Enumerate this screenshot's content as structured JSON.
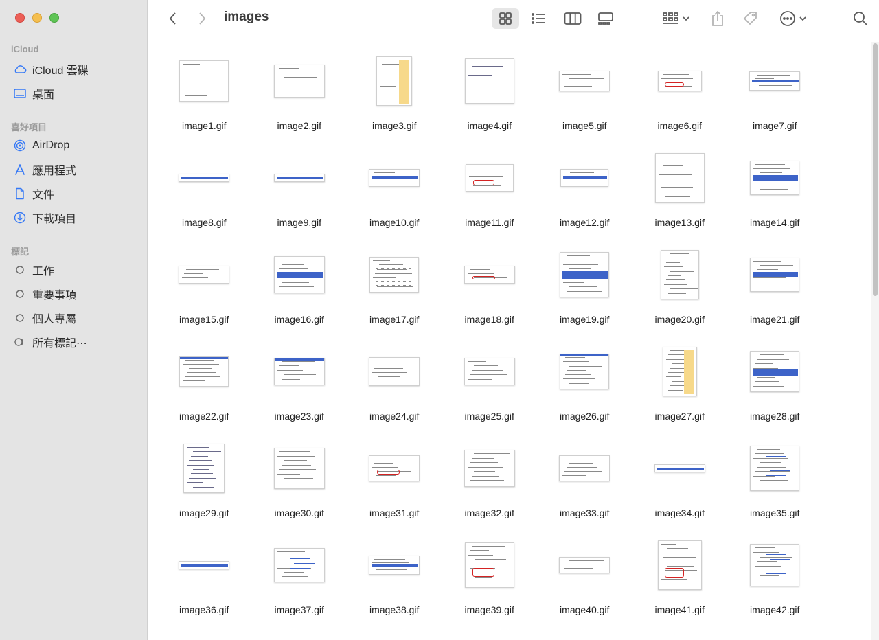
{
  "window": {
    "folder_title": "images"
  },
  "sidebar": {
    "icloud_header": "iCloud",
    "icloud_items": [
      {
        "label": "iCloud 雲碟",
        "icon": "cloud-icon"
      },
      {
        "label": "桌面",
        "icon": "desktop-icon"
      }
    ],
    "favorites_header": "喜好項目",
    "favorite_items": [
      {
        "label": "AirDrop",
        "icon": "airdrop-icon"
      },
      {
        "label": "應用程式",
        "icon": "applications-icon"
      },
      {
        "label": "文件",
        "icon": "document-icon"
      },
      {
        "label": "下載項目",
        "icon": "download-icon"
      }
    ],
    "tags_header": "標記",
    "tag_items": [
      {
        "label": "工作",
        "icon": "tag-circle-icon"
      },
      {
        "label": "重要事項",
        "icon": "tag-circle-icon"
      },
      {
        "label": "個人專屬",
        "icon": "tag-circle-icon"
      },
      {
        "label": "所有標記⋯",
        "icon": "all-tags-icon"
      }
    ]
  },
  "colors": {
    "accent": "#3478f6",
    "sidebar_bg": "#e4e4e4"
  },
  "files": [
    {
      "name": "image1.gif"
    },
    {
      "name": "image2.gif"
    },
    {
      "name": "image3.gif"
    },
    {
      "name": "image4.gif"
    },
    {
      "name": "image5.gif"
    },
    {
      "name": "image6.gif"
    },
    {
      "name": "image7.gif"
    },
    {
      "name": "image8.gif"
    },
    {
      "name": "image9.gif"
    },
    {
      "name": "image10.gif"
    },
    {
      "name": "image11.gif"
    },
    {
      "name": "image12.gif"
    },
    {
      "name": "image13.gif"
    },
    {
      "name": "image14.gif"
    },
    {
      "name": "image15.gif"
    },
    {
      "name": "image16.gif"
    },
    {
      "name": "image17.gif"
    },
    {
      "name": "image18.gif"
    },
    {
      "name": "image19.gif"
    },
    {
      "name": "image20.gif"
    },
    {
      "name": "image21.gif"
    },
    {
      "name": "image22.gif"
    },
    {
      "name": "image23.gif"
    },
    {
      "name": "image24.gif"
    },
    {
      "name": "image25.gif"
    },
    {
      "name": "image26.gif"
    },
    {
      "name": "image27.gif"
    },
    {
      "name": "image28.gif"
    },
    {
      "name": "image29.gif"
    },
    {
      "name": "image30.gif"
    },
    {
      "name": "image31.gif"
    },
    {
      "name": "image32.gif"
    },
    {
      "name": "image33.gif"
    },
    {
      "name": "image34.gif"
    },
    {
      "name": "image35.gif"
    },
    {
      "name": "image36.gif"
    },
    {
      "name": "image37.gif"
    },
    {
      "name": "image38.gif"
    },
    {
      "name": "image39.gif"
    },
    {
      "name": "image40.gif"
    },
    {
      "name": "image41.gif"
    },
    {
      "name": "image42.gif"
    }
  ]
}
